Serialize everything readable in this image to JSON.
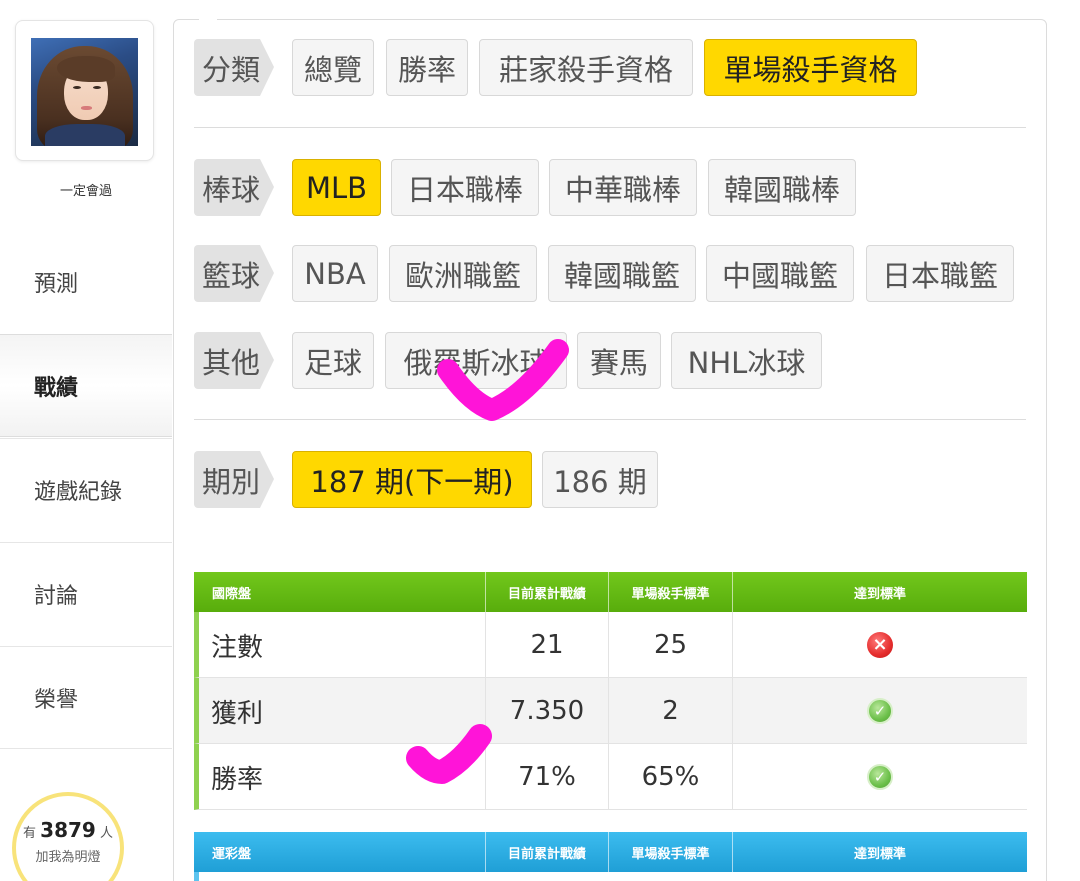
{
  "user": {
    "name": "一定會過"
  },
  "nav": {
    "predict": "預測",
    "record": "戰績",
    "games": "遊戲紀錄",
    "discuss": "討論",
    "honor": "榮譽"
  },
  "fans": {
    "prefix": "有",
    "count": "3879",
    "suffix": "人",
    "action": "加我為明燈"
  },
  "filters": {
    "category": {
      "label": "分類",
      "options": [
        "總覽",
        "勝率",
        "莊家殺手資格",
        "單場殺手資格"
      ],
      "selected": "單場殺手資格"
    },
    "baseball": {
      "label": "棒球",
      "options": [
        "MLB",
        "日本職棒",
        "中華職棒",
        "韓國職棒"
      ],
      "selected": "MLB"
    },
    "basketball": {
      "label": "籃球",
      "options": [
        "NBA",
        "歐洲職籃",
        "韓國職籃",
        "中國職籃",
        "日本職籃"
      ]
    },
    "other": {
      "label": "其他",
      "options": [
        "足球",
        "俄羅斯冰球",
        "賽馬",
        "NHL冰球"
      ]
    },
    "period": {
      "label": "期別",
      "options": [
        "187 期(下一期)",
        "186 期"
      ],
      "selected": "187 期(下一期)"
    }
  },
  "table_intl": {
    "headers": [
      "國際盤",
      "目前累計戰績",
      "單場殺手標準",
      "達到標準"
    ],
    "rows": [
      {
        "label": "注數",
        "current": "21",
        "standard": "25",
        "status": "fail"
      },
      {
        "label": "獲利",
        "current": "7.350",
        "standard": "2",
        "status": "pass"
      },
      {
        "label": "勝率",
        "current": "71%",
        "standard": "65%",
        "status": "pass"
      }
    ]
  },
  "table_lottery": {
    "headers": [
      "運彩盤",
      "目前累計戰績",
      "單場殺手標準",
      "達到標準"
    ]
  },
  "icons": {
    "fail": "x-circle-icon",
    "pass": "check-circle-icon"
  },
  "colors": {
    "selected": "#ffd800",
    "table_green": "#62b812",
    "table_blue": "#27a9e1",
    "annotation": "#ff14d8"
  }
}
